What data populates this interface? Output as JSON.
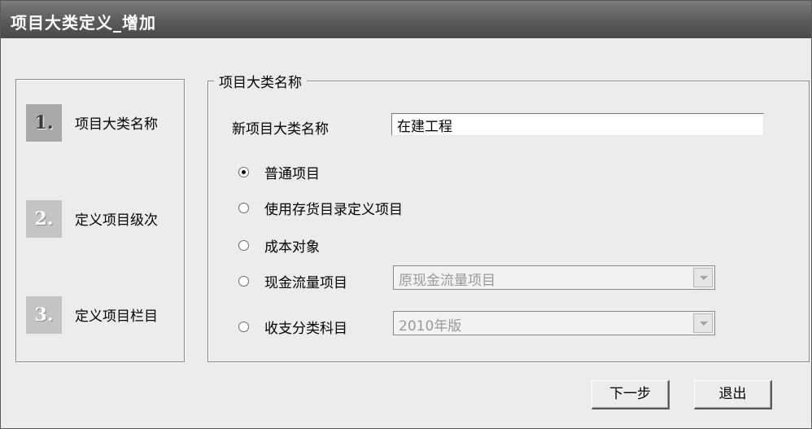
{
  "window": {
    "title": "项目大类定义_增加"
  },
  "steps": [
    {
      "number": "1.",
      "label": "项目大类名称",
      "active": true
    },
    {
      "number": "2.",
      "label": "定义项目级次",
      "active": false
    },
    {
      "number": "3.",
      "label": "定义项目栏目",
      "active": false
    }
  ],
  "group": {
    "title": "项目大类名称",
    "name_label": "新项目大类名称",
    "name_value": "在建工程"
  },
  "options": [
    {
      "label": "普通项目",
      "checked": true
    },
    {
      "label": "使用存货目录定义项目",
      "checked": false
    },
    {
      "label": "成本对象",
      "checked": false
    },
    {
      "label": "现金流量项目",
      "checked": false,
      "select_value": "原现金流量项目"
    },
    {
      "label": "收支分类科目",
      "checked": false,
      "select_value": "2010年版"
    }
  ],
  "buttons": {
    "next": "下一步",
    "exit": "退出"
  }
}
